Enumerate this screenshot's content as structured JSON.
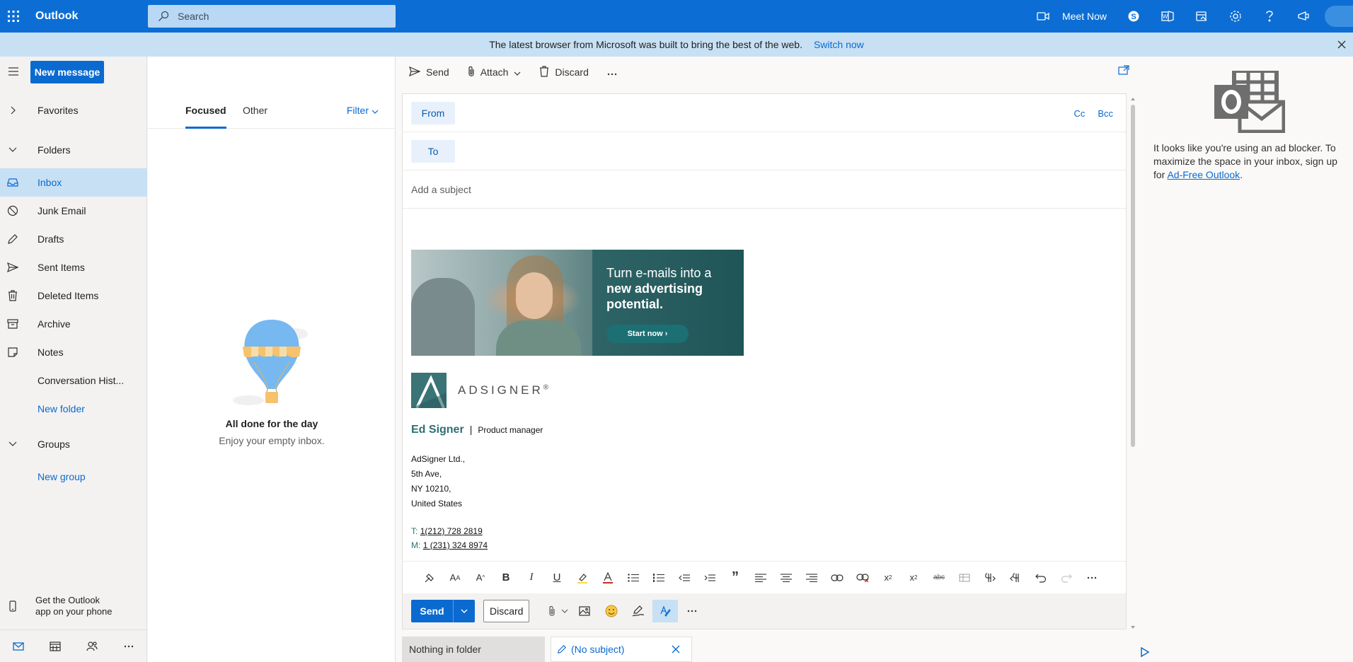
{
  "app": {
    "name": "Outlook"
  },
  "header": {
    "search_placeholder": "Search",
    "meet_now": "Meet Now"
  },
  "banner": {
    "text": "The latest browser from Microsoft was built to bring the best of the web.",
    "link": "Switch now"
  },
  "nav": {
    "new_message": "New message",
    "favorites": "Favorites",
    "folders": "Folders",
    "items": [
      {
        "label": "Inbox",
        "icon": "inbox-icon"
      },
      {
        "label": "Junk Email",
        "icon": "junk-icon"
      },
      {
        "label": "Drafts",
        "icon": "pencil-icon"
      },
      {
        "label": "Sent Items",
        "icon": "send-icon"
      },
      {
        "label": "Deleted Items",
        "icon": "trash-icon"
      },
      {
        "label": "Archive",
        "icon": "archive-icon"
      },
      {
        "label": "Notes",
        "icon": "note-icon"
      },
      {
        "label": "Conversation Hist...",
        "icon": ""
      }
    ],
    "new_folder": "New folder",
    "groups": "Groups",
    "new_group": "New group",
    "get_app_line1": "Get the Outlook",
    "get_app_line2": "app on your phone"
  },
  "list": {
    "tab_focused": "Focused",
    "tab_other": "Other",
    "filter": "Filter",
    "empty_title": "All done for the day",
    "empty_subtitle": "Enjoy your empty inbox."
  },
  "compose": {
    "toolbar": {
      "send": "Send",
      "attach": "Attach",
      "discard": "Discard"
    },
    "from": "From",
    "to": "To",
    "cc": "Cc",
    "bcc": "Bcc",
    "subject_placeholder": "Add a subject",
    "ad": {
      "line1": "Turn e-mails into a",
      "line2": "new advertising",
      "line3": "potential.",
      "cta": "Start now ›"
    },
    "logo_text": "ADSIGNER",
    "logo_reg": "®",
    "signature": {
      "name": "Ed Signer",
      "separator": "|",
      "role": "Product manager",
      "address": [
        "AdSigner Ltd.,",
        "5th Ave,",
        "NY 10210,",
        "United States"
      ],
      "phone_t_label": "T:",
      "phone_t": "1(212) 728 2819",
      "phone_m_label": "M:",
      "phone_m": "1 (231) 324 8974"
    },
    "send_button": "Send",
    "discard_button": "Discard"
  },
  "bottom_tabs": {
    "tab1": "Nothing in folder",
    "tab2": "(No subject)"
  },
  "right_pane": {
    "message": "It looks like you're using an ad blocker. To maximize the space in your inbox, sign up for ",
    "link": "Ad-Free Outlook",
    "period": "."
  }
}
